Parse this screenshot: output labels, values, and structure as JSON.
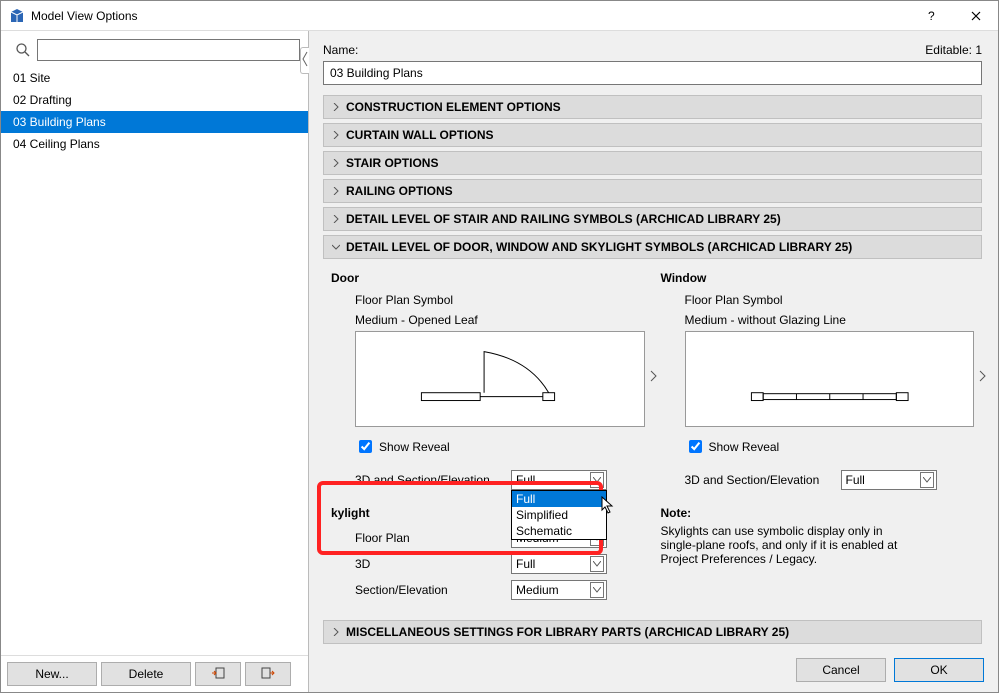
{
  "window": {
    "title": "Model View Options"
  },
  "sidebar": {
    "search_placeholder": "",
    "items": [
      {
        "label": "01 Site"
      },
      {
        "label": "02 Drafting"
      },
      {
        "label": "03 Building Plans",
        "selected": true
      },
      {
        "label": "04 Ceiling Plans"
      }
    ],
    "buttons": {
      "new": "New...",
      "delete": "Delete"
    }
  },
  "main": {
    "name_label": "Name:",
    "editable_label": "Editable: 1",
    "name_value": "03 Building Plans",
    "sections": {
      "construction": "CONSTRUCTION ELEMENT OPTIONS",
      "curtain": "CURTAIN WALL OPTIONS",
      "stair": "STAIR OPTIONS",
      "railing": "RAILING OPTIONS",
      "detail_stair": "DETAIL LEVEL OF STAIR AND RAILING SYMBOLS (ARCHICAD LIBRARY 25)",
      "detail_door": "DETAIL LEVEL OF DOOR, WINDOW AND SKYLIGHT SYMBOLS (ARCHICAD LIBRARY 25)",
      "misc": "MISCELLANEOUS SETTINGS FOR LIBRARY PARTS (ARCHICAD LIBRARY 25)"
    },
    "door": {
      "title": "Door",
      "fps_label": "Floor Plan Symbol",
      "preview_label": "Medium - Opened Leaf",
      "show_reveal": "Show Reveal",
      "se_label": "3D and Section/Elevation",
      "se_value": "Full",
      "se_options": [
        "Full",
        "Simplified",
        "Schematic"
      ]
    },
    "window": {
      "title": "Window",
      "fps_label": "Floor Plan Symbol",
      "preview_label": "Medium - without Glazing Line",
      "show_reveal": "Show Reveal",
      "se_label": "3D and Section/Elevation",
      "se_value": "Full"
    },
    "skylight": {
      "title": "kylight",
      "floor_plan_label": "Floor Plan",
      "floor_plan_value": "Medium",
      "d3_label": "3D",
      "d3_value": "Full",
      "se_label": "Section/Elevation",
      "se_value": "Medium"
    },
    "note": {
      "title": "Note:",
      "body": "Skylights can use symbolic display only in single-plane roofs, and only if it is enabled at Project Preferences / Legacy."
    }
  },
  "footer": {
    "cancel": "Cancel",
    "ok": "OK"
  }
}
